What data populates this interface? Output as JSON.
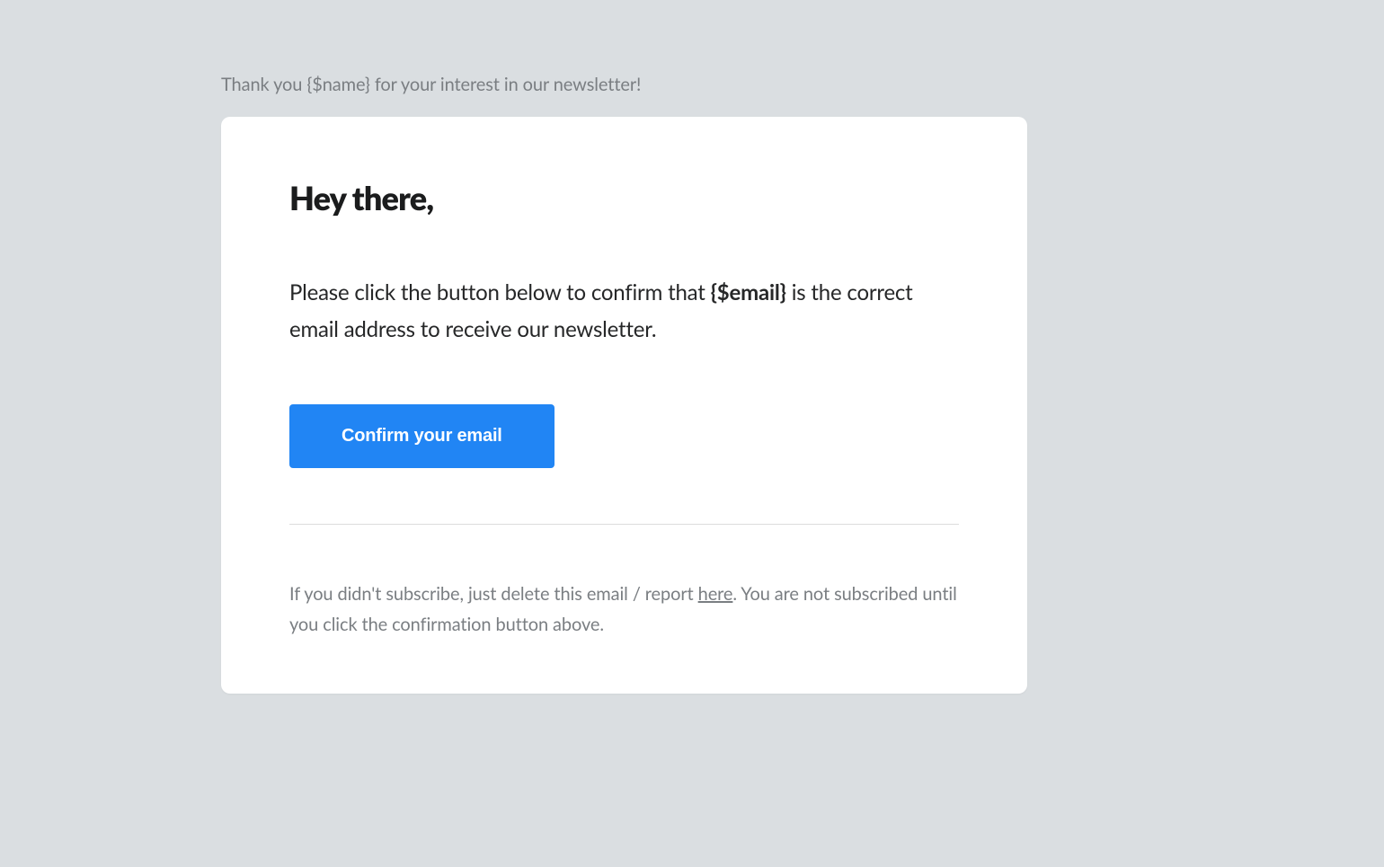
{
  "pretext": "Thank you {$name} for your interest in our newsletter!",
  "card": {
    "heading": "Hey there,",
    "body_prefix": "Please click the button below to confirm that ",
    "body_placeholder": "{$email}",
    "body_suffix": " is the correct email address to receive our newsletter.",
    "button_label": "Confirm your email",
    "footer_prefix": "If you didn't subscribe, just delete this email / report ",
    "footer_link": "here",
    "footer_suffix": ". You are not subscribed until you click the confirmation button above."
  }
}
